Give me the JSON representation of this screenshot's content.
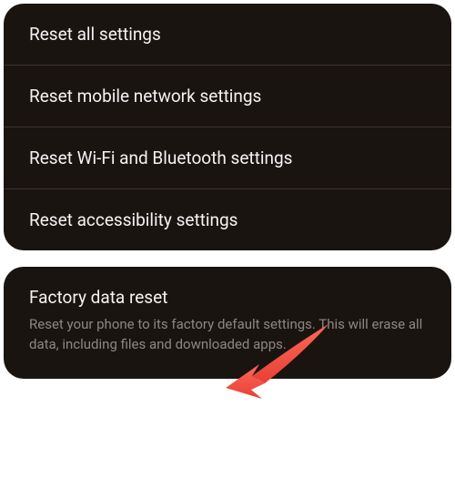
{
  "reset_options": {
    "items": [
      {
        "label": "Reset all settings"
      },
      {
        "label": "Reset mobile network settings"
      },
      {
        "label": "Reset Wi-Fi and Bluetooth settings"
      },
      {
        "label": "Reset accessibility settings"
      }
    ]
  },
  "factory": {
    "title": "Factory data reset",
    "description": "Reset your phone to its factory default settings. This will erase all data, including files and downloaded apps."
  },
  "annotation": {
    "arrow_color": "#f95a4a"
  }
}
